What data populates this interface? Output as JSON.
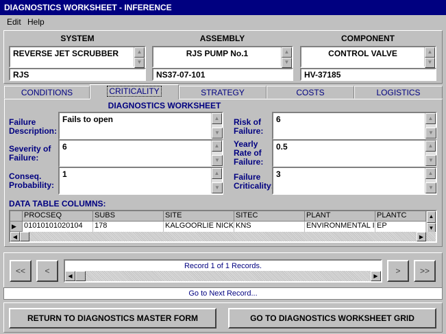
{
  "window": {
    "title": "DIAGNOSTICS WORKSHEET - INFERENCE"
  },
  "menu": {
    "edit": "Edit",
    "help": "Help"
  },
  "header": {
    "system_label": "SYSTEM",
    "assembly_label": "ASSEMBLY",
    "component_label": "COMPONENT",
    "system_name": "REVERSE JET SCRUBBER",
    "system_code": "RJS",
    "assembly_name": "RJS PUMP No.1",
    "assembly_code": "NS37-07-101",
    "component_name": "CONTROL VALVE",
    "component_code": "HV-37185"
  },
  "tabs": [
    "CONDITIONS",
    "CRITICALITY",
    "STRATEGY",
    "COSTS",
    "LOGISTICS"
  ],
  "worksheet": {
    "title": "DIAGNOSTICS WORKSHEET",
    "failure_description_label": "Failure Description:",
    "failure_description": "Fails to open",
    "severity_label": "Severity of Failure:",
    "severity": "6",
    "conseq_label": "Conseq. Probability:",
    "conseq": "1",
    "risk_label": "Risk of Failure:",
    "risk": "6",
    "yearly_label": "Yearly Rate of Failure:",
    "yearly": "0.5",
    "criticality_label": "Failure Criticality:",
    "criticality": "3"
  },
  "table": {
    "title": "DATA TABLE COLUMNS:",
    "columns": [
      "PROCSEQ",
      "SUBS",
      "SITE",
      "SITEC",
      "PLANT",
      "PLANTC"
    ],
    "row": [
      "01010101020104",
      "178",
      "KALGOORLIE NICKI",
      "KNS",
      "ENVIRONMENTAL I",
      "EP"
    ]
  },
  "nav": {
    "first": "<<",
    "prev": "<",
    "next": ">",
    "last": ">>",
    "record_status": "Record 1 of 1 Records.",
    "hint": "Go to Next Record..."
  },
  "buttons": {
    "return_master": "RETURN TO DIAGNOSTICS MASTER FORM",
    "goto_grid": "GO TO DIAGNOSTICS WORKSHEET GRID"
  }
}
